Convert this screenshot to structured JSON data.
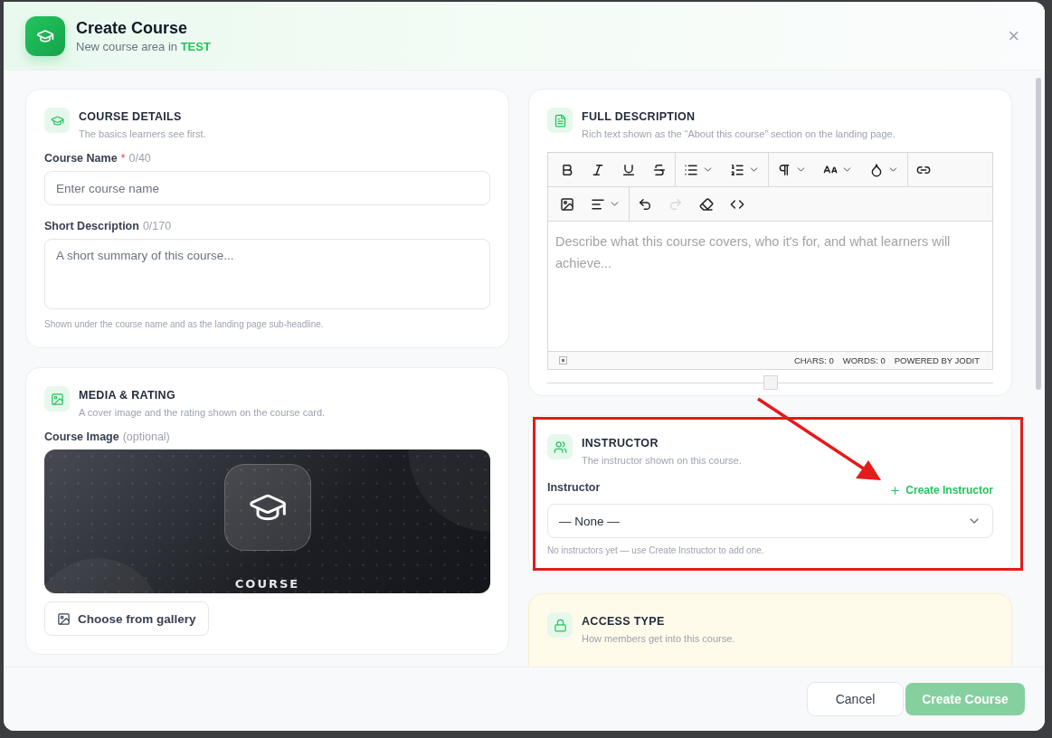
{
  "dialog": {
    "title": "Create Course",
    "subtitle": "New course area in **TEST**",
    "close": "×"
  },
  "course_details": {
    "title": "COURSE DETAILS",
    "subtitle": "The basics learners see first.",
    "name_field": {
      "label": "Course Name",
      "required_mark": "*",
      "counter": "0/40",
      "placeholder": "Enter course name"
    },
    "short_description": {
      "label": "Short Description",
      "counter": "0/170",
      "placeholder": "A short summary of this course...",
      "help": "Shown under the course name and as the landing page sub-headline."
    }
  },
  "media_rating": {
    "title": "MEDIA & RATING",
    "subtitle": "A cover image and the rating shown on the course card.",
    "image_label": "Course Image",
    "image_hint": "(optional)",
    "cover_label": "COURSE",
    "gallery_button": "Choose from gallery"
  },
  "full_description": {
    "title": "FULL DESCRIPTION",
    "subtitle": "Rich text shown as the “About this course” section on the landing page.",
    "toolbar_rows": [
      [
        {
          "dropdown": false,
          "disabled": false
        },
        {
          "dropdown": false,
          "disabled": false
        },
        {
          "dropdown": false,
          "disabled": false
        },
        {
          "dropdown": false,
          "disabled": false,
          "group_end": true
        },
        {
          "dropdown": true,
          "disabled": false
        },
        {
          "dropdown": true,
          "disabled": false,
          "group_end": true
        },
        {
          "dropdown": true,
          "disabled": false
        },
        {
          "dropdown": true,
          "disabled": false
        },
        {
          "dropdown": true,
          "disabled": false,
          "group_end": true
        },
        {
          "dropdown": false,
          "disabled": false
        }
      ],
      [
        {
          "dropdown": false,
          "disabled": false
        },
        {
          "dropdown": true,
          "disabled": false,
          "group_end": true
        },
        {
          "dropdown": false,
          "disabled": false
        },
        {
          "dropdown": false,
          "disabled": true
        },
        {
          "dropdown": false,
          "disabled": false
        },
        {
          "dropdown": false,
          "disabled": false
        }
      ]
    ],
    "placeholder": "Describe what this course covers, who it's for, and what learners will achieve...",
    "status": [
      "CHARS: 0",
      "WORDS: 0",
      "POWERED BY JODIT"
    ]
  },
  "instructor": {
    "title": "INSTRUCTOR",
    "subtitle": "The instructor shown on this course.",
    "label": "Instructor",
    "create_link": "Create Instructor",
    "select_value": "— None —",
    "help": "No instructors yet — use Create Instructor to add one."
  },
  "access_type": {
    "title": "ACCESS TYPE",
    "subtitle": "How members get into this course."
  },
  "footer": {
    "cancel": "Cancel",
    "submit": {
      "label": "Create Course",
      "disabled": true
    }
  }
}
